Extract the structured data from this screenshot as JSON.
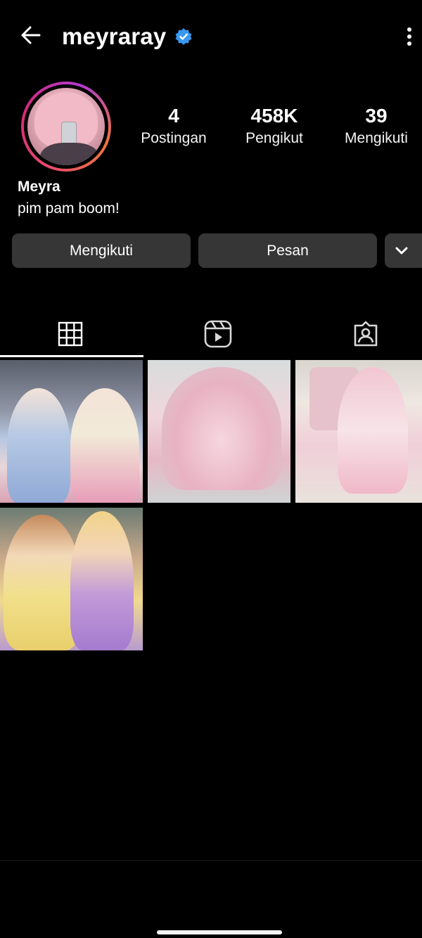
{
  "header": {
    "username": "meyraray",
    "verified": true
  },
  "profile": {
    "display_name": "Meyra",
    "bio": "pim pam boom!",
    "stats": [
      {
        "value": "4",
        "label": "Postingan"
      },
      {
        "value": "458K",
        "label": "Pengikut"
      },
      {
        "value": "39",
        "label": "Mengikuti"
      }
    ]
  },
  "actions": {
    "follow_label": "Mengikuti",
    "message_label": "Pesan"
  },
  "tabs": [
    {
      "icon": "grid-icon",
      "selected": true
    },
    {
      "icon": "reels-icon",
      "selected": false
    },
    {
      "icon": "tagged-icon",
      "selected": false
    }
  ],
  "posts_count_visible": 4,
  "colors": {
    "background": "#000000",
    "button": "#363636",
    "verified_blue": "#3897f0"
  }
}
